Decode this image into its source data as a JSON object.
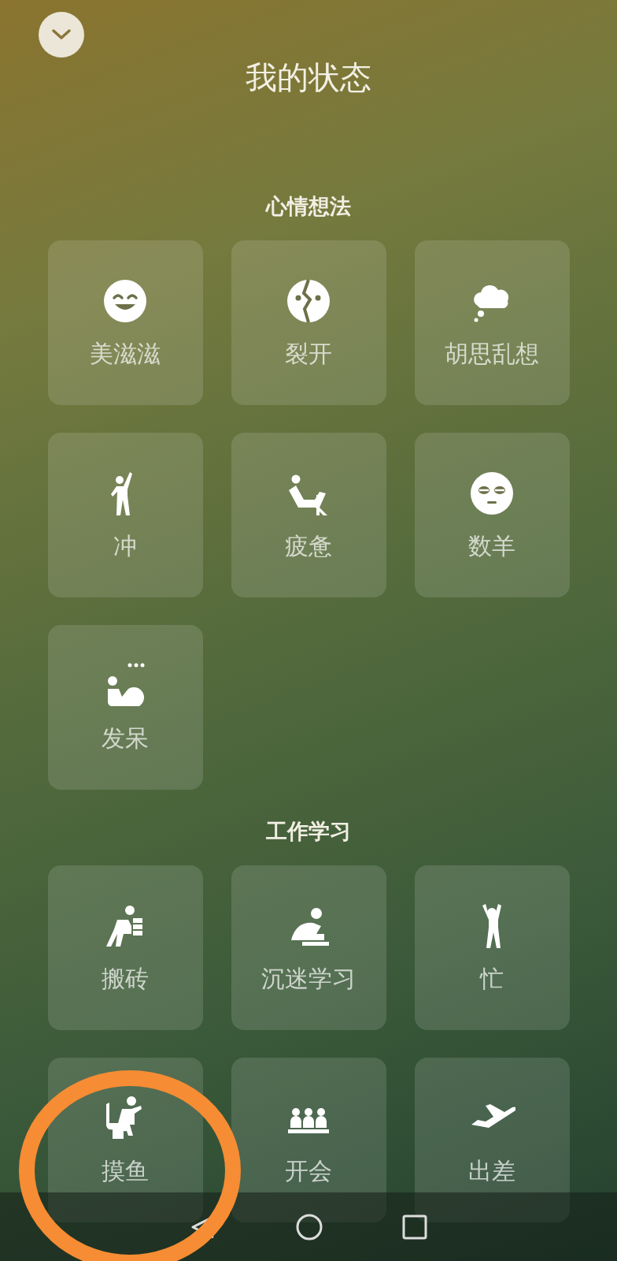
{
  "title": "我的状态",
  "sections": [
    {
      "heading": "心情想法",
      "items": [
        {
          "label": "美滋滋"
        },
        {
          "label": "裂开"
        },
        {
          "label": "胡思乱想"
        },
        {
          "label": "冲"
        },
        {
          "label": "疲惫"
        },
        {
          "label": "数羊"
        },
        {
          "label": "发呆"
        }
      ]
    },
    {
      "heading": "工作学习",
      "items": [
        {
          "label": "搬砖"
        },
        {
          "label": "沉迷学习"
        },
        {
          "label": "忙"
        },
        {
          "label": "摸鱼"
        },
        {
          "label": "开会"
        },
        {
          "label": "出差"
        }
      ]
    }
  ]
}
